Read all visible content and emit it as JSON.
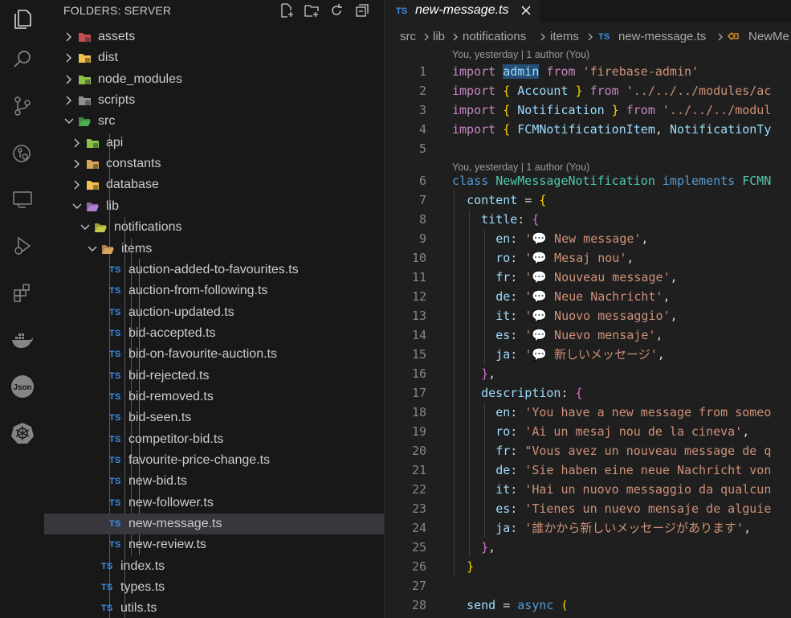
{
  "explorer": {
    "title": "FOLDERS: SERVER",
    "actions": [
      "new-file-icon",
      "new-folder-icon",
      "refresh-icon",
      "collapse-all-icon"
    ],
    "tree": [
      {
        "label": "assets",
        "kind": "folder",
        "expanded": false,
        "depth": 0
      },
      {
        "label": "dist",
        "kind": "folder",
        "expanded": false,
        "depth": 0
      },
      {
        "label": "node_modules",
        "kind": "folder",
        "expanded": false,
        "depth": 0
      },
      {
        "label": "scripts",
        "kind": "folder",
        "expanded": false,
        "depth": 0
      },
      {
        "label": "src",
        "kind": "folder",
        "expanded": true,
        "depth": 0
      },
      {
        "label": "api",
        "kind": "folder",
        "expanded": false,
        "depth": 1
      },
      {
        "label": "constants",
        "kind": "folder",
        "expanded": false,
        "depth": 1
      },
      {
        "label": "database",
        "kind": "folder",
        "expanded": false,
        "depth": 1
      },
      {
        "label": "lib",
        "kind": "folder",
        "expanded": true,
        "depth": 1
      },
      {
        "label": "notifications",
        "kind": "folder",
        "expanded": true,
        "depth": 2
      },
      {
        "label": "items",
        "kind": "folder",
        "expanded": true,
        "depth": 3
      },
      {
        "label": "auction-added-to-favourites.ts",
        "kind": "ts",
        "depth": 4
      },
      {
        "label": "auction-from-following.ts",
        "kind": "ts",
        "depth": 4
      },
      {
        "label": "auction-updated.ts",
        "kind": "ts",
        "depth": 4
      },
      {
        "label": "bid-accepted.ts",
        "kind": "ts",
        "depth": 4
      },
      {
        "label": "bid-on-favourite-auction.ts",
        "kind": "ts",
        "depth": 4
      },
      {
        "label": "bid-rejected.ts",
        "kind": "ts",
        "depth": 4
      },
      {
        "label": "bid-removed.ts",
        "kind": "ts",
        "depth": 4
      },
      {
        "label": "bid-seen.ts",
        "kind": "ts",
        "depth": 4
      },
      {
        "label": "competitor-bid.ts",
        "kind": "ts",
        "depth": 4
      },
      {
        "label": "favourite-price-change.ts",
        "kind": "ts",
        "depth": 4
      },
      {
        "label": "new-bid.ts",
        "kind": "ts",
        "depth": 4
      },
      {
        "label": "new-follower.ts",
        "kind": "ts",
        "depth": 4
      },
      {
        "label": "new-message.ts",
        "kind": "ts",
        "depth": 4,
        "selected": true
      },
      {
        "label": "new-review.ts",
        "kind": "ts",
        "depth": 4
      },
      {
        "label": "index.ts",
        "kind": "ts",
        "depth": 3
      },
      {
        "label": "types.ts",
        "kind": "ts",
        "depth": 3
      },
      {
        "label": "utils.ts",
        "kind": "ts",
        "depth": 3
      }
    ],
    "ts_badge": "TS"
  },
  "activity_bar": [
    "explorer-icon",
    "search-icon",
    "source-control-icon",
    "git-graph-icon",
    "remote-explorer-icon",
    "run-debug-icon",
    "extensions-icon",
    "docker-icon",
    "json-icon",
    "kubernetes-icon"
  ],
  "editor": {
    "tab": {
      "label": "new-message.ts",
      "badge": "TS"
    },
    "breadcrumbs": [
      "src",
      "lib",
      "notifications",
      "items",
      "new-message.ts",
      "NewMe"
    ],
    "lens_1": "You, yesterday | 1 author (You)",
    "lens_6": "You, yesterday | 1 author (You)",
    "lines": [
      {
        "n": "1",
        "tokens": [
          [
            "kw2",
            "import "
          ],
          [
            "hl var",
            "admin"
          ],
          [
            "kw2",
            " from "
          ],
          [
            "str",
            "'firebase-admin'"
          ]
        ]
      },
      {
        "n": "2",
        "tokens": [
          [
            "kw2",
            "import "
          ],
          [
            "br1",
            "{ "
          ],
          [
            "var",
            "Account"
          ],
          [
            "br1",
            " }"
          ],
          [
            "kw2",
            " from "
          ],
          [
            "str",
            "'../../../modules/ac"
          ]
        ]
      },
      {
        "n": "3",
        "tokens": [
          [
            "kw2",
            "import "
          ],
          [
            "br1",
            "{ "
          ],
          [
            "var",
            "Notification"
          ],
          [
            "br1",
            " }"
          ],
          [
            "kw2",
            " from "
          ],
          [
            "str",
            "'../../../modul"
          ]
        ]
      },
      {
        "n": "4",
        "tokens": [
          [
            "kw2",
            "import "
          ],
          [
            "br1",
            "{ "
          ],
          [
            "var",
            "FCMNotificationItem"
          ],
          [
            "pun",
            ", "
          ],
          [
            "var",
            "NotificationTy"
          ]
        ]
      },
      {
        "n": "5",
        "tokens": []
      },
      {
        "n": "6",
        "tokens": [
          [
            "kw",
            "class "
          ],
          [
            "cls",
            "NewMessageNotification "
          ],
          [
            "kw",
            "implements "
          ],
          [
            "cls",
            "FCMN"
          ]
        ]
      },
      {
        "n": "7",
        "tokens": [
          [
            "pun",
            "  "
          ],
          [
            "prop",
            "content"
          ],
          [
            "pun",
            " = "
          ],
          [
            "br1",
            "{"
          ]
        ]
      },
      {
        "n": "8",
        "tokens": [
          [
            "pun",
            "    "
          ],
          [
            "prop",
            "title"
          ],
          [
            "pun",
            ": "
          ],
          [
            "br2",
            "{"
          ]
        ]
      },
      {
        "n": "9",
        "tokens": [
          [
            "pun",
            "      "
          ],
          [
            "prop",
            "en"
          ],
          [
            "pun",
            ": "
          ],
          [
            "str",
            "'💬 New message'"
          ],
          [
            "pun",
            ","
          ]
        ]
      },
      {
        "n": "10",
        "tokens": [
          [
            "pun",
            "      "
          ],
          [
            "prop",
            "ro"
          ],
          [
            "pun",
            ": "
          ],
          [
            "str",
            "'💬 Mesaj nou'"
          ],
          [
            "pun",
            ","
          ]
        ]
      },
      {
        "n": "11",
        "tokens": [
          [
            "pun",
            "      "
          ],
          [
            "prop",
            "fr"
          ],
          [
            "pun",
            ": "
          ],
          [
            "str",
            "'💬 Nouveau message'"
          ],
          [
            "pun",
            ","
          ]
        ]
      },
      {
        "n": "12",
        "tokens": [
          [
            "pun",
            "      "
          ],
          [
            "prop",
            "de"
          ],
          [
            "pun",
            ": "
          ],
          [
            "str",
            "'💬 Neue Nachricht'"
          ],
          [
            "pun",
            ","
          ]
        ]
      },
      {
        "n": "13",
        "tokens": [
          [
            "pun",
            "      "
          ],
          [
            "prop",
            "it"
          ],
          [
            "pun",
            ": "
          ],
          [
            "str",
            "'💬 Nuovo messaggio'"
          ],
          [
            "pun",
            ","
          ]
        ]
      },
      {
        "n": "14",
        "tokens": [
          [
            "pun",
            "      "
          ],
          [
            "prop",
            "es"
          ],
          [
            "pun",
            ": "
          ],
          [
            "str",
            "'💬 Nuevo mensaje'"
          ],
          [
            "pun",
            ","
          ]
        ]
      },
      {
        "n": "15",
        "tokens": [
          [
            "pun",
            "      "
          ],
          [
            "prop",
            "ja"
          ],
          [
            "pun",
            ": "
          ],
          [
            "str",
            "'💬 新しいメッセージ'"
          ],
          [
            "pun",
            ","
          ]
        ]
      },
      {
        "n": "16",
        "tokens": [
          [
            "pun",
            "    "
          ],
          [
            "br2",
            "}"
          ],
          [
            "pun",
            ","
          ]
        ]
      },
      {
        "n": "17",
        "tokens": [
          [
            "pun",
            "    "
          ],
          [
            "prop",
            "description"
          ],
          [
            "pun",
            ": "
          ],
          [
            "br2",
            "{"
          ]
        ]
      },
      {
        "n": "18",
        "tokens": [
          [
            "pun",
            "      "
          ],
          [
            "prop",
            "en"
          ],
          [
            "pun",
            ": "
          ],
          [
            "str",
            "'You have a new message from someo"
          ]
        ]
      },
      {
        "n": "19",
        "tokens": [
          [
            "pun",
            "      "
          ],
          [
            "prop",
            "ro"
          ],
          [
            "pun",
            ": "
          ],
          [
            "str",
            "'Ai un mesaj nou de la cineva'"
          ],
          [
            "pun",
            ","
          ]
        ]
      },
      {
        "n": "20",
        "tokens": [
          [
            "pun",
            "      "
          ],
          [
            "prop",
            "fr"
          ],
          [
            "pun",
            ": "
          ],
          [
            "str",
            "\"Vous avez un nouveau message de q"
          ]
        ]
      },
      {
        "n": "21",
        "tokens": [
          [
            "pun",
            "      "
          ],
          [
            "prop",
            "de"
          ],
          [
            "pun",
            ": "
          ],
          [
            "str",
            "'Sie haben eine neue Nachricht von"
          ]
        ]
      },
      {
        "n": "22",
        "tokens": [
          [
            "pun",
            "      "
          ],
          [
            "prop",
            "it"
          ],
          [
            "pun",
            ": "
          ],
          [
            "str",
            "'Hai un nuovo messaggio da qualcun"
          ]
        ]
      },
      {
        "n": "23",
        "tokens": [
          [
            "pun",
            "      "
          ],
          [
            "prop",
            "es"
          ],
          [
            "pun",
            ": "
          ],
          [
            "str",
            "'Tienes un nuevo mensaje de alguie"
          ]
        ]
      },
      {
        "n": "24",
        "tokens": [
          [
            "pun",
            "      "
          ],
          [
            "prop",
            "ja"
          ],
          [
            "pun",
            ": "
          ],
          [
            "str",
            "'誰かから新しいメッセージがあります'"
          ],
          [
            "pun",
            ","
          ]
        ]
      },
      {
        "n": "25",
        "tokens": [
          [
            "pun",
            "    "
          ],
          [
            "br2",
            "}"
          ],
          [
            "pun",
            ","
          ]
        ]
      },
      {
        "n": "26",
        "tokens": [
          [
            "pun",
            "  "
          ],
          [
            "br1",
            "}"
          ]
        ]
      },
      {
        "n": "27",
        "tokens": []
      },
      {
        "n": "28",
        "tokens": [
          [
            "pun",
            "  "
          ],
          [
            "prop",
            "send"
          ],
          [
            "pun",
            " = "
          ],
          [
            "kw",
            "async "
          ],
          [
            "br1",
            "("
          ]
        ]
      }
    ]
  }
}
